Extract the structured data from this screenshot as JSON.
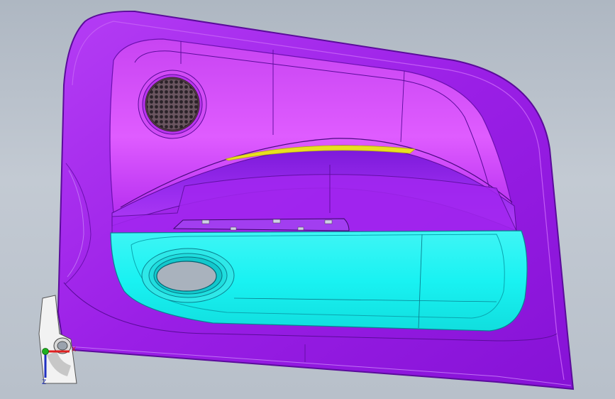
{
  "viewport": {
    "background_top": "#aeb7c2",
    "background_bottom": "#b8c0ca"
  },
  "model": {
    "description_colors": {
      "panel": "#9a1fe6",
      "panel_edge": "#6b10b0",
      "upper_trim": "#c33af2",
      "upper_highlight": "#e46bff",
      "map_pocket": "#19f2f2",
      "map_pocket_edge": "#0aa6b0",
      "armrest_highlight": "#e8e020",
      "speaker_grille": "#6f5a63",
      "bracket": "#f2f2f2"
    }
  },
  "triad": {
    "x_label": "X",
    "z_label": "Z",
    "x_color": "#e02020",
    "y_color": "#20b020",
    "z_color": "#2030c0"
  }
}
